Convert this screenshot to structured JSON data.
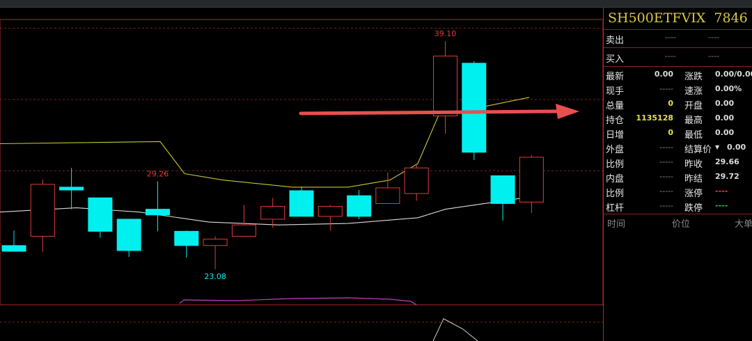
{
  "colors": {
    "up": "#e03c3c",
    "down": "#00f0f0",
    "grid_dash": "#7a2020",
    "frame": "#b02a2a",
    "ma_upper": "#c8c832",
    "ma_lower": "#dcdcdc",
    "purple": "#c040c0",
    "arrow": "#e85050"
  },
  "panel": {
    "symbol": "SH500ETFVIX",
    "code": "7846",
    "sell_label": "卖出",
    "buy_label": "买入",
    "sell_v1": "----",
    "sell_v2": "----",
    "buy_v1": "----",
    "buy_v2": "----",
    "rows": [
      {
        "l1": "最新",
        "v1": "0.00",
        "l2": "涨跌",
        "v2": "0.00/0.00%"
      },
      {
        "l1": "现手",
        "v1": "-----",
        "l2": "速涨",
        "v2": "0.00%"
      },
      {
        "l1": "总量",
        "v1": "0",
        "l2": "开盘",
        "v2": "0.00"
      },
      {
        "l1": "持仓",
        "v1": "1135128",
        "l2": "最高",
        "v2": "0.00"
      },
      {
        "l1": "日增",
        "v1": "0",
        "l2": "最低",
        "v2": "0.00"
      },
      {
        "l1": "外盘",
        "v1": "-----",
        "l2": "结算价",
        "v2": "0.00"
      },
      {
        "l1": "比例",
        "v1": "-----",
        "l2": "昨收",
        "v2": "29.66"
      },
      {
        "l1": "内盘",
        "v1": "-----",
        "l2": "昨结",
        "v2": "29.72"
      },
      {
        "l1": "比例",
        "v1": "-----",
        "l2": "涨停",
        "v2": "----"
      },
      {
        "l1": "杠杆",
        "v1": "-----",
        "l2": "跌停",
        "v2": "----"
      }
    ],
    "footer": {
      "time": "时间",
      "price": "价位",
      "big": "大单"
    }
  },
  "chart_data": {
    "type": "candlestick",
    "title": "",
    "ylim": [
      20.0,
      41.0
    ],
    "candles": [
      {
        "open": 24.75,
        "close": 24.35,
        "high": 25.8,
        "low": 24.35
      },
      {
        "open": 25.4,
        "close": 29.05,
        "high": 29.4,
        "low": 24.3
      },
      {
        "open": 28.85,
        "close": 28.65,
        "high": 30.2,
        "low": 27.3
      },
      {
        "open": 28.1,
        "close": 25.75,
        "high": 28.1,
        "low": 25.3
      },
      {
        "open": 26.6,
        "close": 24.4,
        "high": 26.6,
        "low": 23.95
      },
      {
        "open": 27.3,
        "close": 26.9,
        "high": 29.26,
        "low": 25.75
      },
      {
        "open": 25.75,
        "close": 24.75,
        "high": 25.8,
        "low": 23.9
      },
      {
        "open": 24.75,
        "close": 25.2,
        "high": 25.4,
        "low": 23.08
      },
      {
        "open": 25.4,
        "close": 26.2,
        "high": 27.6,
        "low": 25.4
      },
      {
        "open": 26.6,
        "close": 27.5,
        "high": 28.1,
        "low": 26.0
      },
      {
        "open": 28.6,
        "close": 26.8,
        "high": 28.9,
        "low": 26.8
      },
      {
        "open": 26.8,
        "close": 27.5,
        "high": 27.6,
        "low": 25.8
      },
      {
        "open": 28.25,
        "close": 26.8,
        "high": 28.65,
        "low": 26.6
      },
      {
        "open": 27.7,
        "close": 28.8,
        "high": 29.9,
        "low": 27.7
      },
      {
        "open": 28.4,
        "close": 30.2,
        "high": 30.4,
        "low": 27.9
      },
      {
        "open": 33.85,
        "close": 38.05,
        "high": 39.1,
        "low": 32.6
      },
      {
        "open": 37.55,
        "close": 31.3,
        "high": 37.7,
        "low": 30.75
      },
      {
        "open": 29.65,
        "close": 27.7,
        "high": 29.65,
        "low": 26.5
      },
      {
        "open": 27.8,
        "close": 30.95,
        "high": 31.1,
        "low": 27.05
      }
    ],
    "upper_band": [
      [
        0,
        31.9
      ],
      [
        230,
        32.05
      ],
      [
        265,
        29.8
      ],
      [
        320,
        29.35
      ],
      [
        420,
        28.85
      ],
      [
        500,
        28.85
      ],
      [
        560,
        29.35
      ],
      [
        600,
        30.5
      ],
      [
        630,
        33.9
      ],
      [
        700,
        34.55
      ],
      [
        760,
        35.15
      ]
    ],
    "lower_band": [
      [
        0,
        27.1
      ],
      [
        110,
        27.4
      ],
      [
        200,
        27.1
      ],
      [
        300,
        26.4
      ],
      [
        400,
        26.2
      ],
      [
        500,
        26.3
      ],
      [
        600,
        26.7
      ],
      [
        640,
        27.3
      ],
      [
        760,
        28.15
      ]
    ],
    "labels": [
      {
        "text": "39.10",
        "candle": 15,
        "at": "high",
        "color": "#e03c3c"
      },
      {
        "text": "29.26",
        "candle": 5,
        "at": "high",
        "color": "#e03c3c"
      },
      {
        "text": "23.08",
        "candle": 7,
        "at": "low",
        "color": "#00f0f0"
      }
    ],
    "dashed_grid_values": [
      40.0,
      35.0,
      30.0
    ]
  }
}
